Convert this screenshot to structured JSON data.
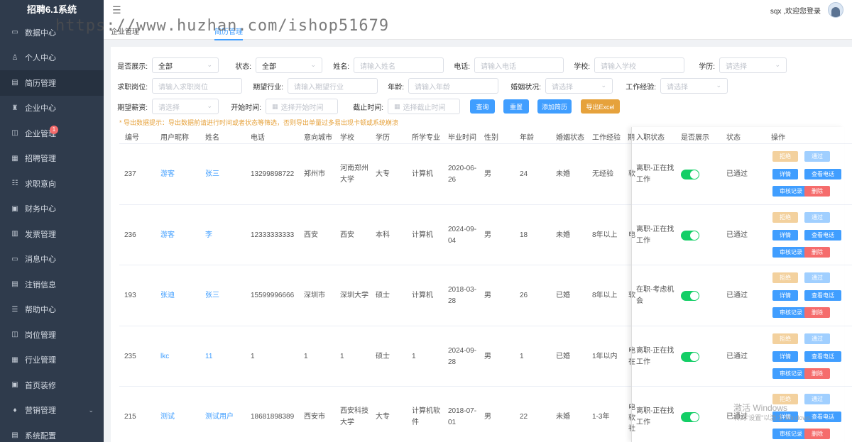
{
  "app": {
    "title": "招聘6.1系统"
  },
  "watermark": "https://www.huzhan.com/ishop51679",
  "user": {
    "greeting": "sqx ,欢迎您登录"
  },
  "sidebar": {
    "items": [
      {
        "label": "数据中心",
        "icon": "chart-icon"
      },
      {
        "label": "个人中心",
        "icon": "user-icon"
      },
      {
        "label": "简历管理",
        "icon": "document-icon"
      },
      {
        "label": "企业中心",
        "icon": "company-icon"
      },
      {
        "label": "企业管理",
        "icon": "cube-icon",
        "badge": "1"
      },
      {
        "label": "招聘管理",
        "icon": "grid-icon"
      },
      {
        "label": "求职意向",
        "icon": "list-icon"
      },
      {
        "label": "财务中心",
        "icon": "wallet-icon"
      },
      {
        "label": "发票管理",
        "icon": "clipboard-icon"
      },
      {
        "label": "消息中心",
        "icon": "message-icon"
      },
      {
        "label": "注销信息",
        "icon": "logout-icon"
      },
      {
        "label": "帮助中心",
        "icon": "help-icon"
      },
      {
        "label": "岗位管理",
        "icon": "box-icon"
      },
      {
        "label": "行业管理",
        "icon": "industry-icon"
      },
      {
        "label": "首页装修",
        "icon": "home-icon"
      },
      {
        "label": "营销管理",
        "icon": "marketing-icon"
      },
      {
        "label": "系统配置",
        "icon": "settings-icon"
      }
    ]
  },
  "tabs": [
    {
      "label": "企业管理"
    },
    {
      "label": "简历管理"
    }
  ],
  "filters": {
    "show_label": "是否展示:",
    "show_value": "全部",
    "status_label": "状态:",
    "status_value": "全部",
    "name_label": "姓名:",
    "name_ph": "请输入姓名",
    "phone_label": "电话:",
    "phone_ph": "请输入电话",
    "school_label": "学校:",
    "school_ph": "请输入学校",
    "edu_label": "学历:",
    "edu_ph": "请选择",
    "job_label": "求职岗位:",
    "job_ph": "请输入求职岗位",
    "industry_label": "期望行业:",
    "industry_ph": "请输入期望行业",
    "age_label": "年龄:",
    "age_ph": "请输入年龄",
    "marital_label": "婚姻状况:",
    "marital_ph": "请选择",
    "exp_label": "工作经验:",
    "exp_ph": "请选择",
    "salary_label": "期望薪资:",
    "salary_ph": "请选择",
    "start_label": "开始时间:",
    "start_ph": "选择开始时间",
    "end_label": "截止时间:",
    "end_ph": "选择截止时间",
    "btn_query": "查询",
    "btn_reset": "重置",
    "btn_add": "添加简历",
    "btn_export": "导出Excel"
  },
  "hint": "* 导出数据提示：导出数据前请进行时间或者状态等筛选，否则导出单量过多易出现卡顿或系统崩溃",
  "table": {
    "headers": [
      "编号",
      "用户昵称",
      "姓名",
      "电话",
      "意向城市",
      "学校",
      "学历",
      "所学专业",
      "毕业时间",
      "性别",
      "年龄",
      "婚姻状态",
      "工作经验",
      "期",
      "入职状态",
      "是否展示",
      "状态",
      "操作"
    ],
    "actions": {
      "reject": "拒绝",
      "pass": "通过",
      "detail": "详情",
      "view_phone": "查看电话",
      "audit": "审核记录",
      "delete": "删除"
    },
    "rows": [
      {
        "id": "237",
        "nick": "游客",
        "name": "张三",
        "phone": "13299898722",
        "city": "郑州市",
        "school1": "河南郑州",
        "school2": "大学",
        "edu": "大专",
        "major1": "计算机",
        "major2": "",
        "grad1": "2020-06-",
        "grad2": "26",
        "gender": "男",
        "age": "24",
        "marital": "未婚",
        "exp": "无经验",
        "cut1": "软",
        "cut2": "",
        "cut3": "",
        "entry1": "离职-正在找",
        "entry2": "工作",
        "status": "已通过"
      },
      {
        "id": "236",
        "nick": "游客",
        "name": "李",
        "phone": "12333333333",
        "city": "西安",
        "school1": "西安",
        "school2": "",
        "edu": "本科",
        "major1": "计算机",
        "major2": "",
        "grad1": "2024-09-",
        "grad2": "04",
        "gender": "男",
        "age": "18",
        "marital": "未婚",
        "exp": "8年以上",
        "cut1": "电",
        "cut2": "",
        "cut3": "",
        "entry1": "离职-正在找",
        "entry2": "工作",
        "status": "已通过"
      },
      {
        "id": "193",
        "nick": "张迪",
        "name": "张三",
        "phone": "15599996666",
        "city": "深圳市",
        "school1": "深圳大学",
        "school2": "",
        "edu": "硕士",
        "major1": "计算机",
        "major2": "",
        "grad1": "2018-03-",
        "grad2": "28",
        "gender": "男",
        "age": "26",
        "marital": "已婚",
        "exp": "8年以上",
        "cut1": "软",
        "cut2": "",
        "cut3": "",
        "entry1": "在职-考虑机",
        "entry2": "会",
        "status": "已通过"
      },
      {
        "id": "235",
        "nick": "lkc",
        "name": "11",
        "phone": "1",
        "city": "1",
        "school1": "1",
        "school2": "",
        "edu": "硕士",
        "major1": "1",
        "major2": "",
        "grad1": "2024-09-",
        "grad2": "28",
        "gender": "男",
        "age": "1",
        "marital": "已婚",
        "exp": "1年以内",
        "cut1": "电",
        "cut2": "在",
        "cut3": "",
        "entry1": "离职-正在找",
        "entry2": "工作",
        "status": "已通过"
      },
      {
        "id": "215",
        "nick": "测试",
        "name": "测试用户",
        "phone": "18681898389",
        "city": "西安市",
        "school1": "西安科技",
        "school2": "大学",
        "edu": "大专",
        "major1": "计算机软",
        "major2": "件",
        "grad1": "2018-07-",
        "grad2": "01",
        "gender": "男",
        "age": "22",
        "marital": "未婚",
        "exp": "1-3年",
        "cut1": "电",
        "cut2": "软",
        "cut3": "社",
        "entry1": "离职-正在找",
        "entry2": "工作",
        "status": "已通过"
      }
    ]
  },
  "windows_watermark": {
    "line1": "激活 Windows",
    "line2": "转到\"设置\"以激活 Windows。"
  },
  "colors": {
    "sidebar": "#2f3b4c",
    "primary": "#409eff",
    "warning": "#e6a23c",
    "danger": "#f56c6c",
    "success": "#13ce66"
  }
}
